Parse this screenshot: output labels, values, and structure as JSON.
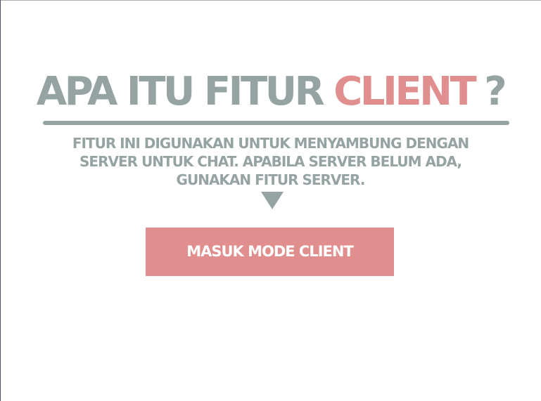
{
  "header": {
    "title_prefix": "APA ITU FITUR",
    "title_highlight": "CLIENT",
    "title_suffix": "?"
  },
  "description": {
    "lines": [
      "FITUR INI DIGUNAKAN UNTUK MENYAMBUNG DENGAN",
      "SERVER UNTUK CHAT. APABILA SERVER BELUM ADA,",
      "GUNAKAN FITUR SERVER."
    ]
  },
  "actions": {
    "client_button_label": "MASUK MODE CLIENT"
  },
  "icons": {
    "pointer": "triangle-down-icon"
  },
  "colors": {
    "primary_gray": "#96a3a3",
    "accent_pink": "#e08e8e",
    "background": "#ffffff",
    "button_text": "#ffffff"
  }
}
